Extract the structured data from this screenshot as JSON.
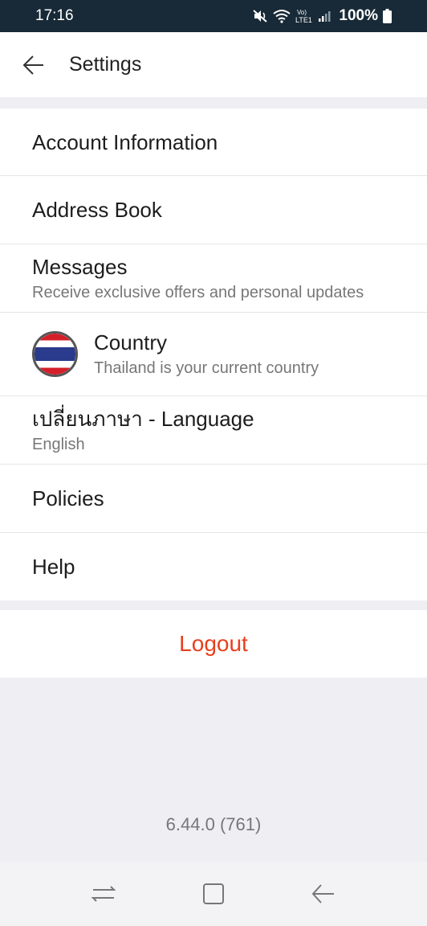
{
  "status_bar": {
    "time": "17:16",
    "battery": "100%",
    "network": "LTE1",
    "network_top": "Vo)"
  },
  "header": {
    "title": "Settings",
    "back_icon": "arrow-left-icon"
  },
  "menu": {
    "account": {
      "label": "Account Information"
    },
    "address": {
      "label": "Address Book"
    },
    "messages": {
      "label": "Messages",
      "subtitle": "Receive exclusive offers and personal updates"
    },
    "country": {
      "label": "Country",
      "subtitle": "Thailand is your current country",
      "flag_icon": "thailand-flag-icon"
    },
    "language": {
      "label": "เปลี่ยนภาษา - Language",
      "subtitle": "English"
    },
    "policies": {
      "label": "Policies"
    },
    "help": {
      "label": "Help"
    }
  },
  "logout": {
    "label": "Logout",
    "color": "#e8401c"
  },
  "version": "6.44.0 (761)",
  "colors": {
    "status_bar": "#182a37",
    "page_bg": "#eeeef3",
    "accent": "#e8401c"
  }
}
